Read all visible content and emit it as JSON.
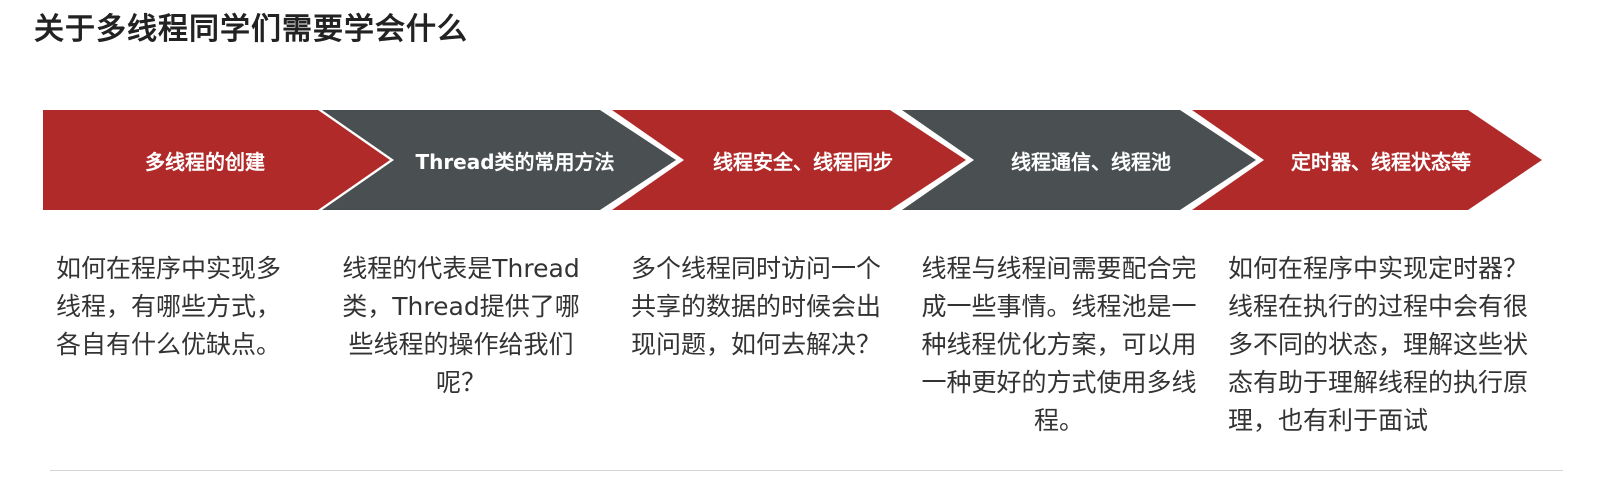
{
  "title": "关于多线程同学们需要学会什么",
  "colors": {
    "red": "#B12A2A",
    "gray": "#4A5052",
    "text": "#333333"
  },
  "steps": [
    {
      "label": "多线程的创建",
      "color": "red",
      "description": "如何在程序中实现多线程，有哪些方式，各自有什么优缺点。"
    },
    {
      "label": "Thread类的常用方法",
      "color": "gray",
      "description": "线程的代表是Thread类，Thread提供了哪些线程的操作给我们呢？"
    },
    {
      "label": "线程安全、线程同步",
      "color": "red",
      "description": "多个线程同时访问一个共享的数据的时候会出现问题，如何去解决？"
    },
    {
      "label": "线程通信、线程池",
      "color": "gray",
      "description": "线程与线程间需要配合完成一些事情。线程池是一种线程优化方案，可以用一种更好的方式使用多线程。"
    },
    {
      "label": "定时器、线程状态等",
      "color": "red",
      "description": "如何在程序中实现定时器？线程在执行的过程中会有很多不同的状态，理解这些状态有助于理解线程的执行原理，也有利于面试"
    }
  ]
}
